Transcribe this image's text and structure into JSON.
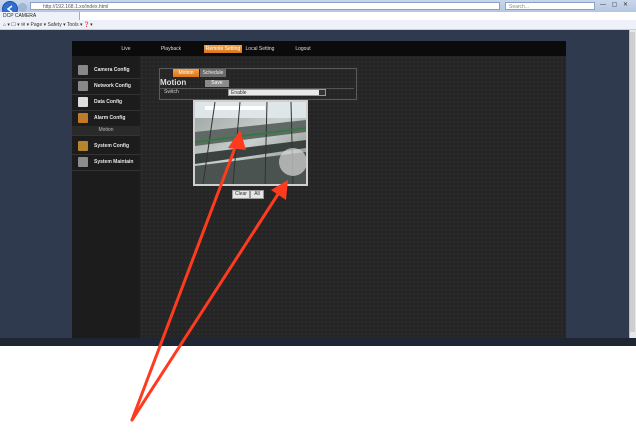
{
  "browser": {
    "address_text": "http://192.168.1.xx/index.html",
    "search_placeholder": "Search...",
    "window_controls": "— ▢ ✕",
    "tab_label": "DCP CAMERA",
    "command_bar": "⌂ ▾  ☐ ▾  ✉ ▾  Page ▾  Safety ▾  Tools ▾  ❓▾"
  },
  "nav": {
    "items": [
      "Live",
      "Playback",
      "Remote Setting",
      "Local Setting",
      "Logout"
    ],
    "active": "Remote Setting"
  },
  "sidebar": {
    "items": [
      {
        "label": "Camera Config",
        "icon": "camera-icon"
      },
      {
        "label": "Network Config",
        "icon": "network-icon"
      },
      {
        "label": "Data Config",
        "icon": "data-icon"
      },
      {
        "label": "Alarm Config",
        "icon": "alarm-icon"
      }
    ],
    "sub_item": "Motion",
    "items_lower": [
      {
        "label": "System Config",
        "icon": "system-icon"
      },
      {
        "label": "System Maintain",
        "icon": "maintain-icon"
      }
    ]
  },
  "panel": {
    "tabs": [
      "Motion",
      "Schedule"
    ],
    "title": "Motion",
    "save_label": "Save",
    "row_label": "Switch",
    "select_value": "Enable"
  },
  "camera": {
    "button_a": "Clear",
    "button_b": "All"
  },
  "colors": {
    "accent": "#e38a2c",
    "page_bg": "#303a4f",
    "content_bg": "#252525",
    "arrow": "#ff3b1f"
  }
}
